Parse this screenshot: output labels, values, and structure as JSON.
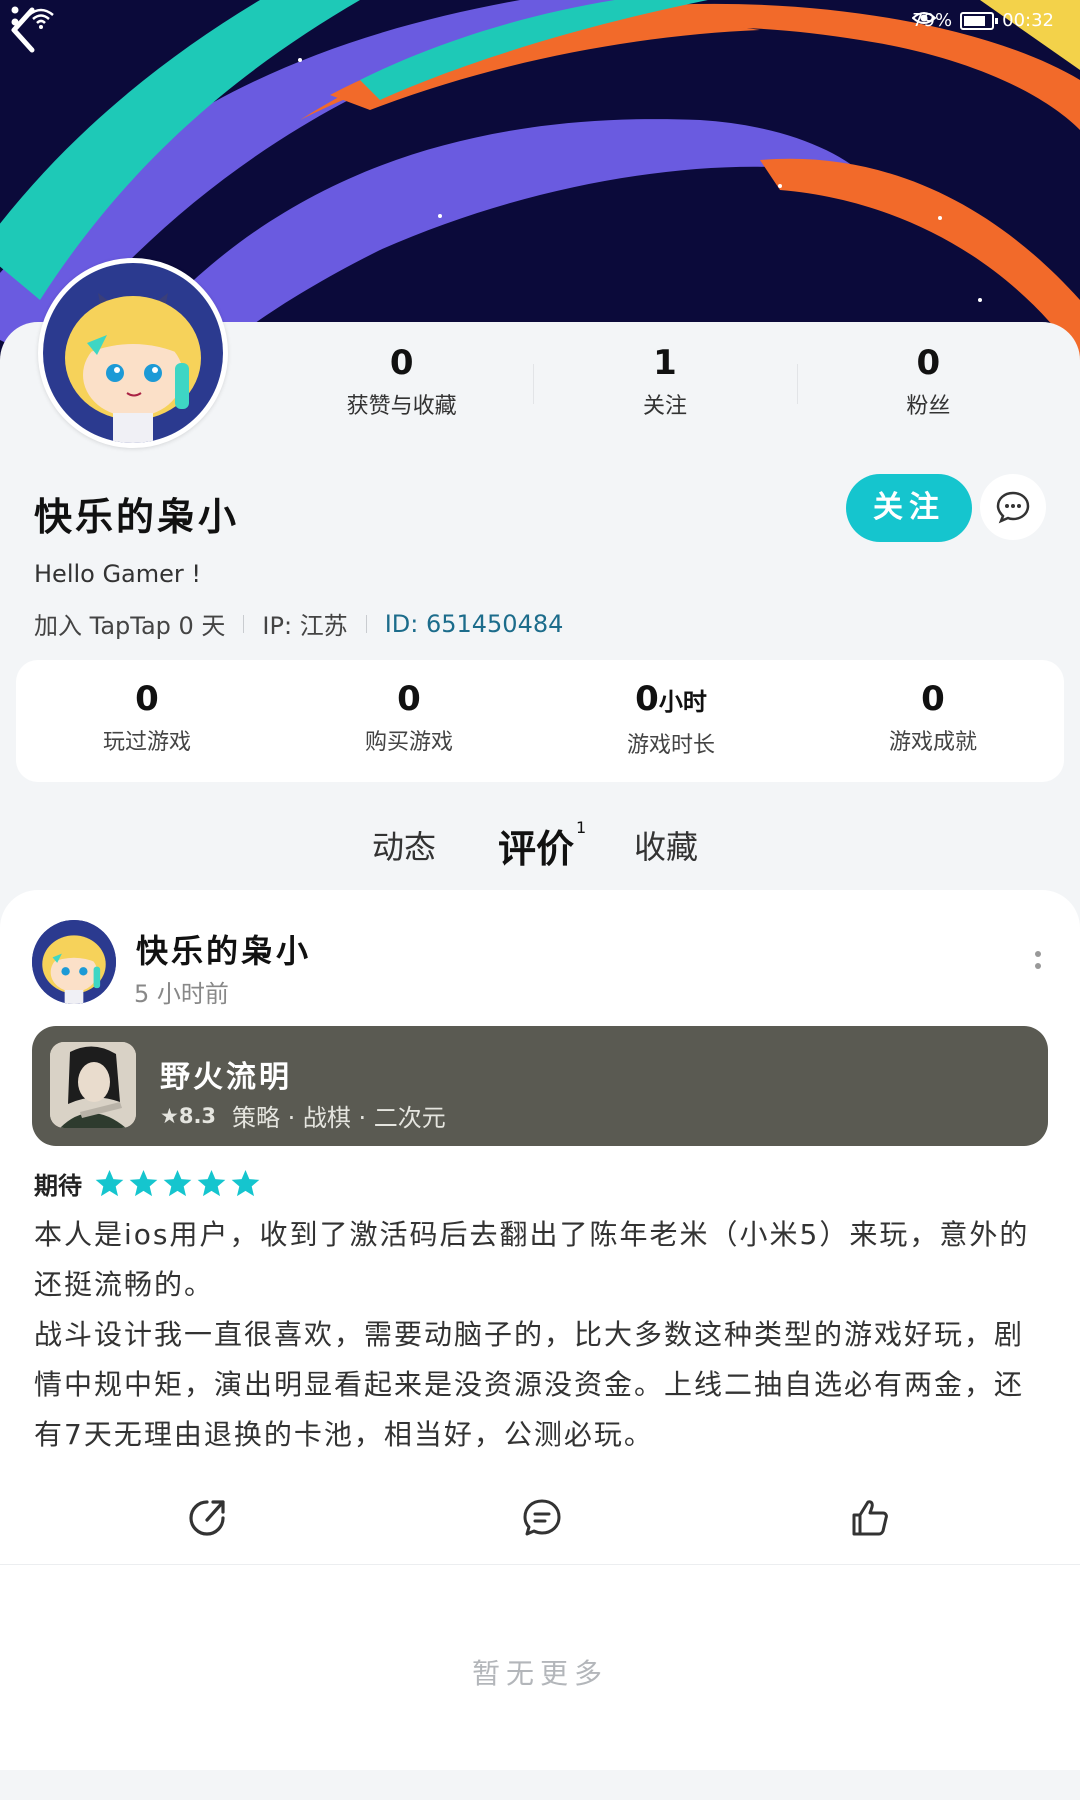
{
  "status_bar": {
    "battery_percent": "79%",
    "battery_level": 0.79,
    "time": "00:32"
  },
  "profile": {
    "stats": [
      {
        "value": "0",
        "label": "获赞与收藏"
      },
      {
        "value": "1",
        "label": "关注"
      },
      {
        "value": "0",
        "label": "粉丝"
      }
    ],
    "username": "快乐的枭小",
    "follow_label": "关注",
    "bio": "Hello Gamer !",
    "joined": "加入 TapTap 0 天",
    "ip": "IP: 江苏",
    "id": "ID: 651450484"
  },
  "game_stats": [
    {
      "value": "0",
      "unit": "",
      "label": "玩过游戏"
    },
    {
      "value": "0",
      "unit": "",
      "label": "购买游戏"
    },
    {
      "value": "0",
      "unit": "小时",
      "label": "游戏时长"
    },
    {
      "value": "0",
      "unit": "",
      "label": "游戏成就"
    }
  ],
  "tabs": {
    "dynamics": "动态",
    "reviews": "评价",
    "reviews_count": "1",
    "favorites": "收藏"
  },
  "review": {
    "username": "快乐的枭小",
    "time": "5 小时前",
    "game": {
      "name": "野火流明",
      "score": "★8.3",
      "tags": "策略 · 战棋 · 二次元"
    },
    "rating_label": "期待",
    "stars": 5,
    "paragraph_1": "本人是ios用户，收到了激活码后去翻出了陈年老米（小米5）来玩，意外的还挺流畅的。",
    "paragraph_2": "战斗设计我一直很喜欢，需要动脑子的，比大多数这种类型的游戏好玩，剧情中规中矩，演出明显看起来是没资源没资金。上线二抽自选必有两金，还有7天无理由退换的卡池，相当好，公测必玩。"
  },
  "footer": {
    "no_more": "暂无更多"
  },
  "colors": {
    "accent": "#15c5ce",
    "banner_bg": "#0b0a3a",
    "game_card": "#5a5a52"
  }
}
